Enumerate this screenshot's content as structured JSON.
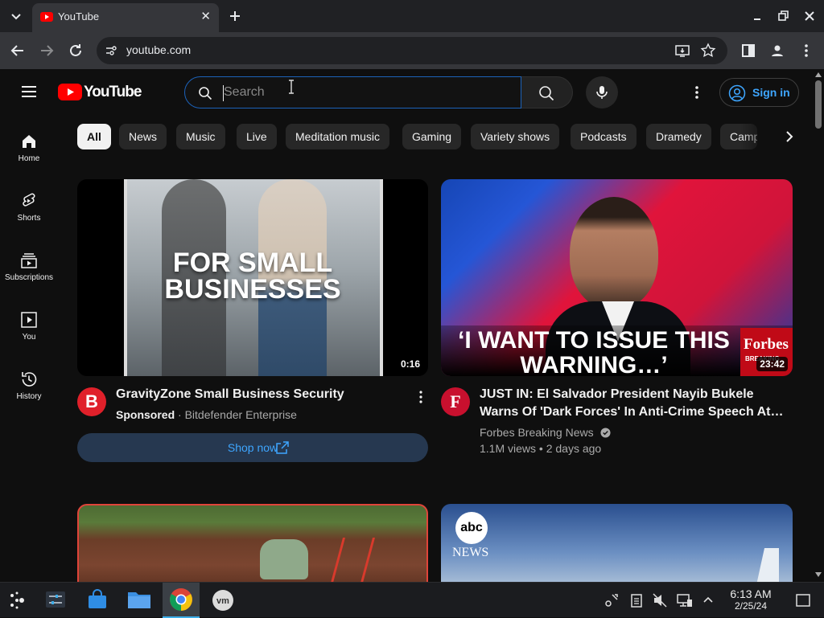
{
  "browser": {
    "tab_title": "YouTube",
    "url": "youtube.com"
  },
  "youtube": {
    "logo_text": "YouTube",
    "search_placeholder": "Search",
    "sign_in_label": "Sign in",
    "chips": [
      "All",
      "News",
      "Music",
      "Live",
      "Meditation music",
      "Gaming",
      "Variety shows",
      "Podcasts",
      "Dramedy",
      "Camp"
    ],
    "guide": [
      {
        "label": "Home",
        "icon": "home-icon"
      },
      {
        "label": "Shorts",
        "icon": "shorts-icon"
      },
      {
        "label": "Subscriptions",
        "icon": "subscriptions-icon"
      },
      {
        "label": "You",
        "icon": "you-icon"
      },
      {
        "label": "History",
        "icon": "history-icon"
      }
    ],
    "videos": [
      {
        "thumb_text": "FOR SMALL BUSINESSES",
        "duration": "0:16",
        "avatar_letter": "B",
        "title": "GravityZone Small Business Security",
        "sponsored": "Sponsored",
        "channel": "Bitdefender Enterprise",
        "cta": "Shop now"
      },
      {
        "thumb_text_1": "‘I WANT TO ISSUE THIS",
        "thumb_text_2": "WARNING…’",
        "brand": "Forbes",
        "brand_sub": "BREAKING",
        "duration": "23:42",
        "avatar_letter": "F",
        "title_1": "JUST IN: El Salvador President Nayib Bukele",
        "title_2": "Warns Of 'Dark Forces' In Anti-Crime Speech At…",
        "channel": "Forbes Breaking News",
        "stats": "1.1M views • 2 days ago"
      },
      {
        "logo": "abc",
        "logo_sub": "NEWS"
      }
    ]
  },
  "taskbar": {
    "time": "6:13 AM",
    "date": "2/25/24"
  },
  "colors": {
    "youtube_red": "#ff0000",
    "link_blue": "#3ea6ff",
    "search_focus": "#1c62b9"
  }
}
